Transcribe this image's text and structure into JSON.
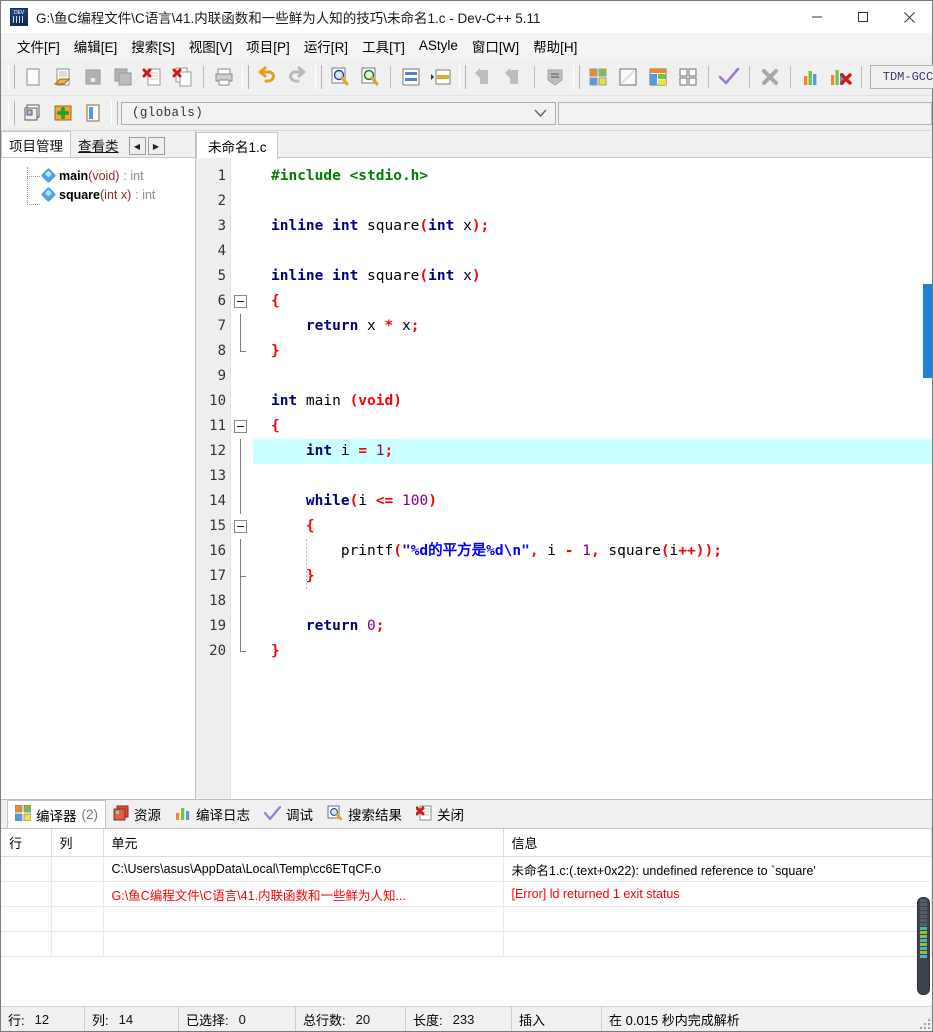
{
  "window": {
    "title": "G:\\鱼C编程文件\\C语言\\41.内联函数和一些鲜为人知的技巧\\未命名1.c - Dev-C++ 5.11",
    "app_icon": "devcpp-logo-icon",
    "minimize_label": "—",
    "maximize_label": "▢",
    "close_label": "✕"
  },
  "menu": {
    "items": [
      {
        "label": "文件[F]"
      },
      {
        "label": "编辑[E]"
      },
      {
        "label": "搜索[S]"
      },
      {
        "label": "视图[V]"
      },
      {
        "label": "项目[P]"
      },
      {
        "label": "运行[R]"
      },
      {
        "label": "工具[T]"
      },
      {
        "label": "AStyle"
      },
      {
        "label": "窗口[W]"
      },
      {
        "label": "帮助[H]"
      }
    ]
  },
  "toolbar": {
    "row1": [
      {
        "name": "new-file-icon"
      },
      {
        "name": "open-file-icon"
      },
      {
        "name": "save-file-icon"
      },
      {
        "name": "save-all-icon"
      },
      {
        "name": "close-file-icon"
      },
      {
        "name": "close-all-icon"
      },
      {
        "name": "print-icon"
      },
      {
        "name": "undo-icon"
      },
      {
        "name": "redo-icon"
      },
      {
        "name": "find-icon"
      },
      {
        "name": "replace-icon"
      },
      {
        "name": "goto-line-icon"
      },
      {
        "name": "goto-function-icon"
      },
      {
        "name": "back-icon"
      },
      {
        "name": "forward-icon"
      },
      {
        "name": "insert-icon"
      },
      {
        "name": "compile-icon"
      },
      {
        "name": "run-icon"
      },
      {
        "name": "compile-run-icon"
      },
      {
        "name": "rebuild-all-icon"
      },
      {
        "name": "syntax-check-icon"
      },
      {
        "name": "stop-execution-icon"
      },
      {
        "name": "profile-icon"
      },
      {
        "name": "delete-profile-icon"
      }
    ],
    "compiler_set": "TDM-GCC",
    "row2": [
      {
        "name": "new-project-icon"
      },
      {
        "name": "add-to-project-icon"
      },
      {
        "name": "remove-from-project-icon"
      }
    ],
    "scope_combo_value": "(globals)",
    "scope_combo_placeholder": "(globals)"
  },
  "left_panel": {
    "tabs": [
      {
        "label": "项目管理",
        "active": true
      },
      {
        "label": "查看类",
        "active": false
      }
    ],
    "nav_prev": "◀",
    "nav_next": "▶",
    "tree": [
      {
        "name": "main",
        "args": "(void)",
        "ret": ": int",
        "icon": "function-icon"
      },
      {
        "name": "square",
        "args": "(int x)",
        "ret": ": int",
        "icon": "function-icon"
      }
    ]
  },
  "editor": {
    "tabs": [
      {
        "label": "未命名1.c",
        "active": true
      }
    ],
    "current_line": 12,
    "lines": [
      {
        "n": 1,
        "fold": "none",
        "tokens": [
          {
            "t": "#include ",
            "c": "pp"
          },
          {
            "t": "<stdio.h>",
            "c": "pp"
          }
        ]
      },
      {
        "n": 2,
        "fold": "none",
        "tokens": []
      },
      {
        "n": 3,
        "fold": "none",
        "tokens": [
          {
            "t": "inline int ",
            "c": "k"
          },
          {
            "t": "square",
            "c": "pl"
          },
          {
            "t": "(",
            "c": "pn"
          },
          {
            "t": "int ",
            "c": "k"
          },
          {
            "t": "x",
            "c": "pl"
          },
          {
            "t": ");",
            "c": "pn"
          }
        ]
      },
      {
        "n": 4,
        "fold": "none",
        "tokens": []
      },
      {
        "n": 5,
        "fold": "none",
        "tokens": [
          {
            "t": "inline int ",
            "c": "k"
          },
          {
            "t": "square",
            "c": "pl"
          },
          {
            "t": "(",
            "c": "pn"
          },
          {
            "t": "int ",
            "c": "k"
          },
          {
            "t": "x",
            "c": "pl"
          },
          {
            "t": ")",
            "c": "pn"
          }
        ]
      },
      {
        "n": 6,
        "fold": "box",
        "tokens": [
          {
            "t": "{",
            "c": "pn"
          }
        ]
      },
      {
        "n": 7,
        "fold": "bar",
        "tokens": [
          {
            "t": "    ",
            "c": "pl"
          },
          {
            "t": "return ",
            "c": "k"
          },
          {
            "t": "x ",
            "c": "pl"
          },
          {
            "t": "* ",
            "c": "pn"
          },
          {
            "t": "x",
            "c": "pl"
          },
          {
            "t": ";",
            "c": "pn"
          }
        ]
      },
      {
        "n": 8,
        "fold": "end",
        "tokens": [
          {
            "t": "}",
            "c": "pn"
          }
        ]
      },
      {
        "n": 9,
        "fold": "none",
        "tokens": []
      },
      {
        "n": 10,
        "fold": "none",
        "tokens": [
          {
            "t": "int ",
            "c": "k"
          },
          {
            "t": "main ",
            "c": "pl"
          },
          {
            "t": "(void)",
            "c": "pn"
          }
        ]
      },
      {
        "n": 11,
        "fold": "box",
        "tokens": [
          {
            "t": "{",
            "c": "pn"
          }
        ]
      },
      {
        "n": 12,
        "fold": "bar",
        "hl": true,
        "tokens": [
          {
            "t": "    ",
            "c": "pl"
          },
          {
            "t": "int ",
            "c": "k"
          },
          {
            "t": "i ",
            "c": "pl"
          },
          {
            "t": "= ",
            "c": "pn"
          },
          {
            "t": "1",
            "c": "nu"
          },
          {
            "t": ";",
            "c": "pn"
          }
        ]
      },
      {
        "n": 13,
        "fold": "bar",
        "tokens": []
      },
      {
        "n": 14,
        "fold": "bar",
        "tokens": [
          {
            "t": "    ",
            "c": "pl"
          },
          {
            "t": "while",
            "c": "k"
          },
          {
            "t": "(",
            "c": "pn"
          },
          {
            "t": "i ",
            "c": "pl"
          },
          {
            "t": "<= ",
            "c": "pn"
          },
          {
            "t": "100",
            "c": "nu"
          },
          {
            "t": ")",
            "c": "pn"
          }
        ]
      },
      {
        "n": 15,
        "fold": "box",
        "tokens": [
          {
            "t": "    ",
            "c": "pl"
          },
          {
            "t": "{",
            "c": "pn"
          }
        ]
      },
      {
        "n": 16,
        "fold": "bar",
        "tokens": [
          {
            "t": "        ",
            "c": "pl"
          },
          {
            "t": "printf",
            "c": "pl"
          },
          {
            "t": "(",
            "c": "pn"
          },
          {
            "t": "\"%d的平方是%d\\n\"",
            "c": "st"
          },
          {
            "t": ", ",
            "c": "pn"
          },
          {
            "t": "i ",
            "c": "pl"
          },
          {
            "t": "- ",
            "c": "pn"
          },
          {
            "t": "1",
            "c": "nu"
          },
          {
            "t": ", ",
            "c": "pn"
          },
          {
            "t": "square",
            "c": "pl"
          },
          {
            "t": "(",
            "c": "pn"
          },
          {
            "t": "i",
            "c": "pl"
          },
          {
            "t": "++));",
            "c": "pn"
          }
        ]
      },
      {
        "n": 17,
        "fold": "tick",
        "tokens": [
          {
            "t": "    ",
            "c": "pl"
          },
          {
            "t": "}",
            "c": "pn"
          }
        ]
      },
      {
        "n": 18,
        "fold": "bar",
        "tokens": []
      },
      {
        "n": 19,
        "fold": "bar",
        "tokens": [
          {
            "t": "    ",
            "c": "pl"
          },
          {
            "t": "return ",
            "c": "k"
          },
          {
            "t": "0",
            "c": "nu"
          },
          {
            "t": ";",
            "c": "pn"
          }
        ]
      },
      {
        "n": 20,
        "fold": "end",
        "tokens": [
          {
            "t": "}",
            "c": "pn"
          }
        ]
      }
    ]
  },
  "bottom_panel": {
    "tabs": [
      {
        "label": "编译器",
        "count": "(2)",
        "icon": "compiler-icon",
        "active": true
      },
      {
        "label": "资源",
        "count": "",
        "icon": "resource-icon",
        "active": false
      },
      {
        "label": "编译日志",
        "count": "",
        "icon": "compile-log-icon",
        "active": false
      },
      {
        "label": "调试",
        "count": "",
        "icon": "debug-check-icon",
        "active": false
      },
      {
        "label": "搜索结果",
        "count": "",
        "icon": "search-results-icon",
        "active": false
      },
      {
        "label": "关闭",
        "count": "",
        "icon": "close-red-icon",
        "active": false
      }
    ],
    "columns": [
      "行",
      "列",
      "单元",
      "信息"
    ],
    "rows": [
      {
        "line": "",
        "col": "",
        "unit": "C:\\Users\\asus\\AppData\\Local\\Temp\\cc6ETqCF.o",
        "message": "未命名1.c:(.text+0x22): undefined reference to `square'",
        "error": false
      },
      {
        "line": "",
        "col": "",
        "unit": "G:\\鱼C编程文件\\C语言\\41.内联函数和一些鲜为人知...",
        "message": "[Error] ld returned 1 exit status",
        "error": true
      }
    ]
  },
  "status_bar": {
    "cells": [
      {
        "label": "行:",
        "value": "12"
      },
      {
        "label": "列:",
        "value": "14"
      },
      {
        "label": "已选择:",
        "value": "0"
      },
      {
        "label": "总行数:",
        "value": "20"
      },
      {
        "label": "长度:",
        "value": "233"
      },
      {
        "label": "插入",
        "value": ""
      },
      {
        "label": "在 0.015 秒内完成解析",
        "value": ""
      }
    ]
  },
  "colors": {
    "accent_blue": "#1e7fd4",
    "highlight_line": "#ccffff",
    "error_red": "#ff0000",
    "keyword_navy": "#000080",
    "string_blue": "#0000ff",
    "preproc_green": "#008000",
    "punct_red": "#ff0000",
    "number_purple": "#800080"
  }
}
